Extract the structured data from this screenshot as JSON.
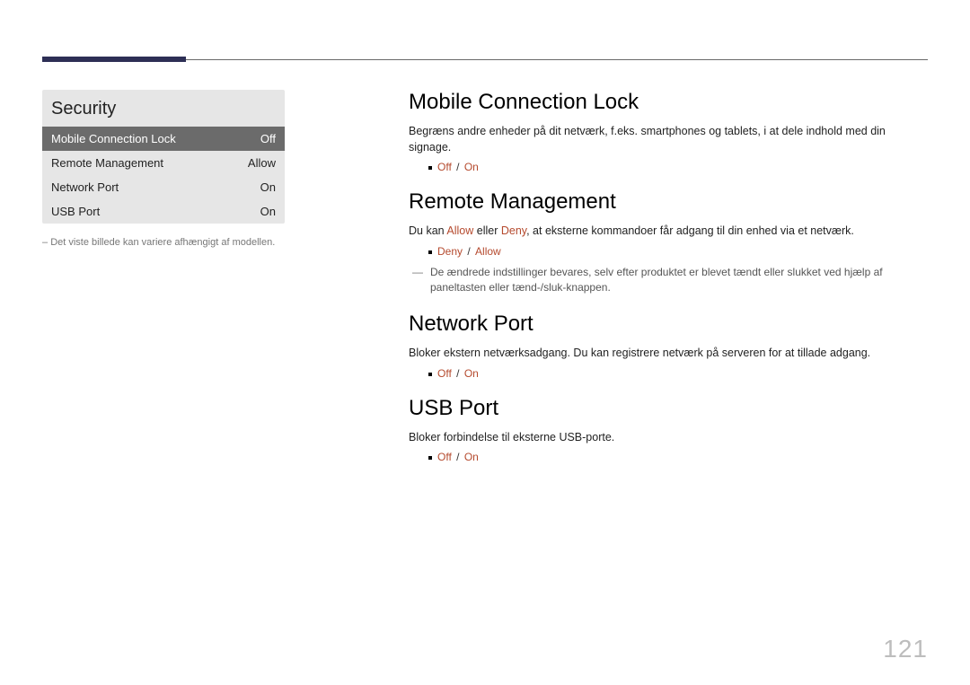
{
  "page_number": "121",
  "left": {
    "panel_title": "Security",
    "rows": [
      {
        "label": "Mobile Connection Lock",
        "value": "Off",
        "selected": true
      },
      {
        "label": "Remote Management",
        "value": "Allow",
        "selected": false
      },
      {
        "label": "Network Port",
        "value": "On",
        "selected": false
      },
      {
        "label": "USB Port",
        "value": "On",
        "selected": false
      }
    ],
    "footnote_dash": "–",
    "footnote": "Det viste billede kan variere afhængigt af modellen."
  },
  "right": {
    "sections": [
      {
        "title": "Mobile Connection Lock",
        "desc": "Begræns andre enheder på dit netværk, f.eks. smartphones og tablets, i at dele indhold med din signage.",
        "opts": [
          "Off",
          "On"
        ],
        "inline": null,
        "note": null
      },
      {
        "title": "Remote Management",
        "desc_pre": "Du kan ",
        "inline": {
          "a": "Allow",
          "mid": " eller ",
          "b": "Deny"
        },
        "desc_post": ", at eksterne kommandoer får adgang til din enhed via et netværk.",
        "opts": [
          "Deny",
          "Allow"
        ],
        "note_dash": "―",
        "note": "De ændrede indstillinger bevares, selv efter produktet er blevet tændt eller slukket ved hjælp af paneltasten eller tænd-/sluk-knappen."
      },
      {
        "title": "Network Port",
        "desc": "Bloker ekstern netværksadgang. Du kan registrere netværk på serveren for at tillade adgang.",
        "opts": [
          "Off",
          "On"
        ],
        "inline": null,
        "note": null
      },
      {
        "title": "USB Port",
        "desc": "Bloker forbindelse til eksterne USB-porte.",
        "opts": [
          "Off",
          "On"
        ],
        "inline": null,
        "note": null
      }
    ]
  }
}
